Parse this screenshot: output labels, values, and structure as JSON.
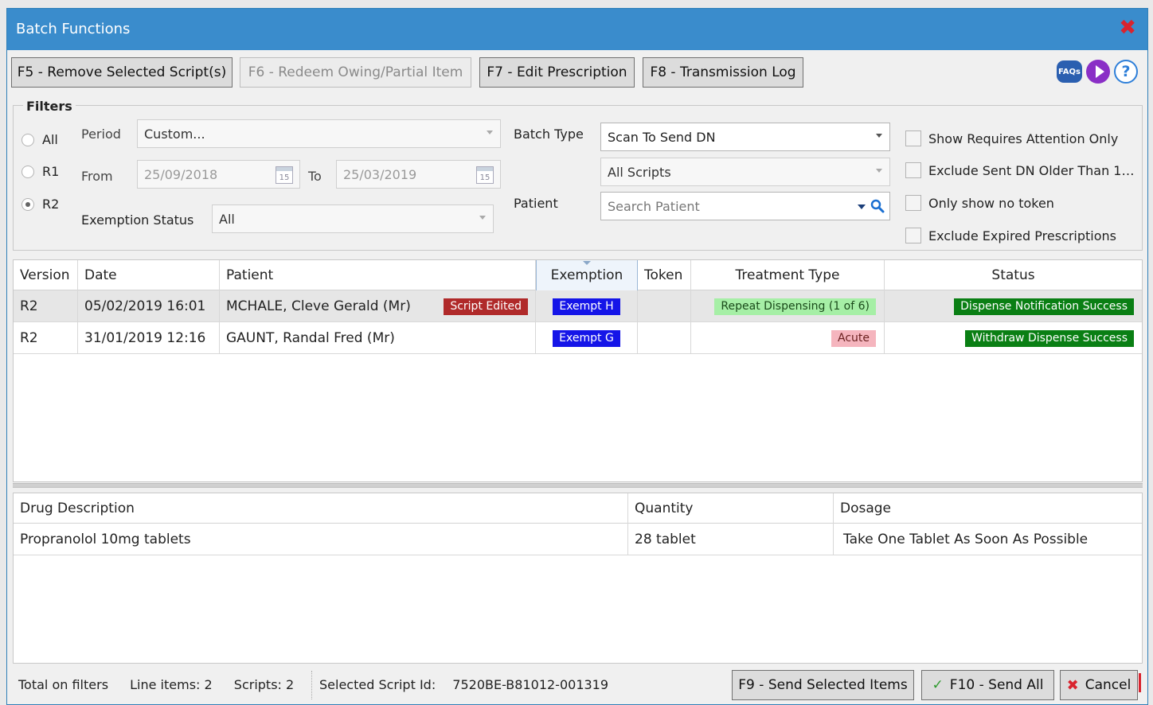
{
  "window": {
    "title": "Batch Functions"
  },
  "toolbar": {
    "remove_label": "F5 - Remove Selected Script(s)",
    "redeem_label": "F6 - Redeem Owing/Partial Item",
    "edit_label": "F7 - Edit Prescription",
    "log_label": "F8 - Transmission Log",
    "faq_text": "FAQs"
  },
  "filters": {
    "legend": "Filters",
    "radios": [
      {
        "label": "All",
        "checked": false
      },
      {
        "label": "R1",
        "checked": false
      },
      {
        "label": "R2",
        "checked": true
      }
    ],
    "period_label": "Period",
    "period_value": "Custom...",
    "from_label": "From",
    "from_value": "25/09/2018",
    "to_label": "To",
    "to_value": "25/03/2019",
    "calendar_day": "15",
    "exemption_status_label": "Exemption Status",
    "exemption_status_value": "All",
    "batch_type_label": "Batch Type",
    "batch_type_value": "Scan To Send DN",
    "scripts_value": "All Scripts",
    "patient_label": "Patient",
    "patient_placeholder": "Search Patient",
    "checkboxes": [
      {
        "label": "Show Requires Attention Only",
        "checked": false
      },
      {
        "label": "Exclude Sent DN Older Than 1…",
        "checked": false
      },
      {
        "label": "Only show no token",
        "checked": false
      },
      {
        "label": "Exclude Expired Prescriptions",
        "checked": false
      }
    ]
  },
  "scripts_grid": {
    "columns": [
      "Version",
      "Date",
      "Patient",
      "Exemption",
      "Token",
      "Treatment Type",
      "Status"
    ],
    "rows": [
      {
        "version": "R2",
        "date": "05/02/2019 16:01",
        "patient": "MCHALE, Cleve Gerald (Mr)",
        "flag": "Script Edited",
        "exemption": "Exempt H",
        "token": "",
        "treatment": "Repeat Dispensing  (1 of 6)",
        "status": "Dispense Notification Success"
      },
      {
        "version": "R2",
        "date": "31/01/2019 12:16",
        "patient": "GAUNT, Randal Fred (Mr)",
        "flag": "",
        "exemption": "Exempt G",
        "token": "",
        "treatment": "Acute",
        "status": "Withdraw Dispense Success"
      }
    ]
  },
  "items_grid": {
    "columns": [
      "Drug Description",
      "Quantity",
      "Dosage"
    ],
    "rows": [
      {
        "drug": "Propranolol 10mg tablets",
        "quantity": "28 tablet",
        "dosage": "Take One Tablet As Soon As Possible"
      }
    ]
  },
  "footer": {
    "total_label": "Total on filters",
    "line_items": "Line items: 2",
    "scripts": "Scripts: 2",
    "selected_id_label": "Selected Script Id:",
    "selected_id_value": "7520BE-B81012-001319",
    "send_selected_label": "F9 - Send Selected Items",
    "send_all_label": "F10 - Send All",
    "cancel_label": "Cancel"
  },
  "colors": {
    "titlebar": "#3a8ccc",
    "close": "#d9232e",
    "script_edited": "#b02a2a",
    "exempt": "#1515e8",
    "repeat": "#a6efa6",
    "acute": "#f5b5be",
    "success": "#0a7f14"
  }
}
